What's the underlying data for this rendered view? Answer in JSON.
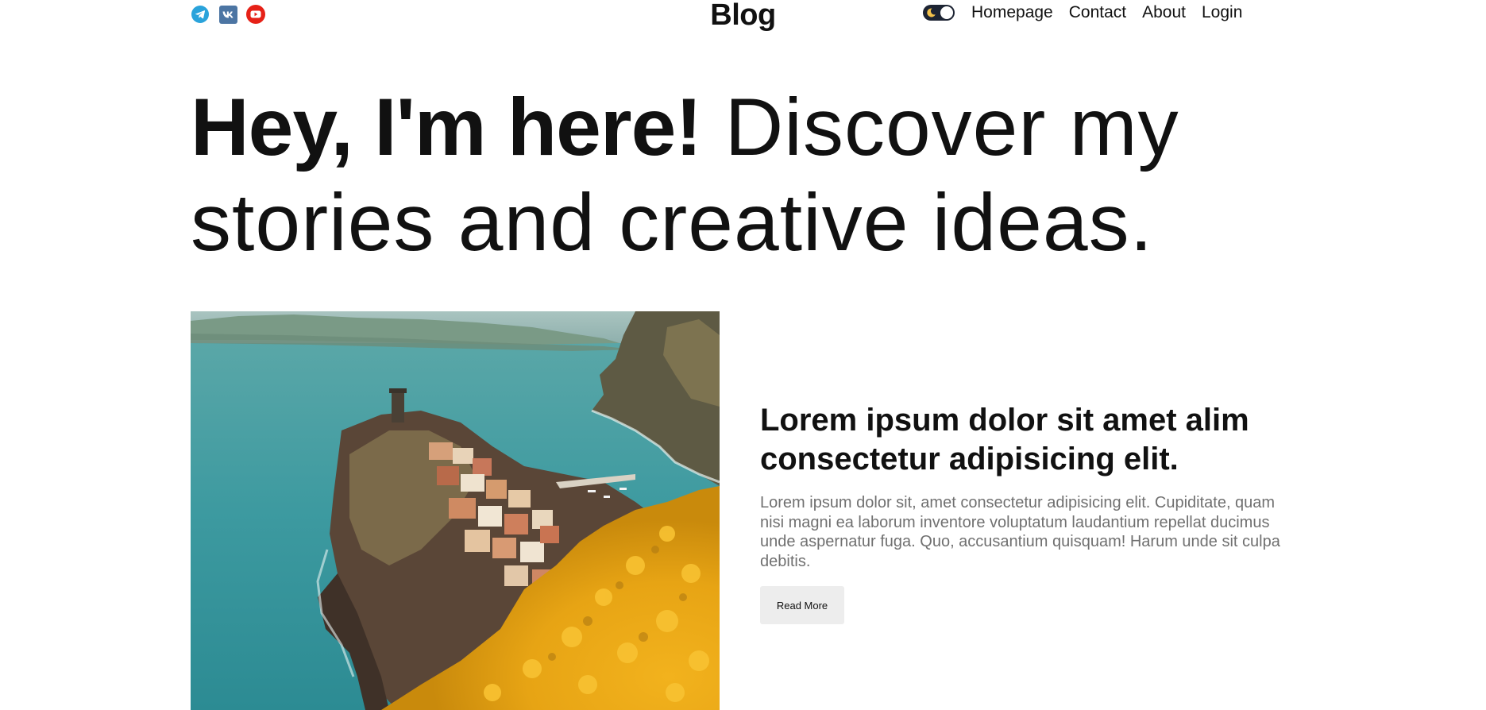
{
  "header": {
    "brand": "Blog",
    "socials": [
      {
        "icon": "telegram-icon",
        "color": "#2aa3db"
      },
      {
        "icon": "vk-icon",
        "color": "#4c75a3"
      },
      {
        "icon": "youtube-icon",
        "color": "#e62117"
      }
    ],
    "theme_toggle": {
      "icon": "moon-icon",
      "track_color": "#1d2433"
    },
    "nav": [
      {
        "label": "Homepage"
      },
      {
        "label": "Contact"
      },
      {
        "label": "About"
      },
      {
        "label": "Login"
      }
    ]
  },
  "hero": {
    "bold": "Hey, I'm here!",
    "light": " Discover my stories and creative ideas."
  },
  "featured_post": {
    "image_alt": "Coastal village on a cliff by the sea with yellow flowers",
    "title": "Lorem ipsum dolor sit amet alim consectetur adipisicing elit.",
    "excerpt": "Lorem ipsum dolor sit, amet consectetur adipisicing elit. Cupiditate, quam nisi magni ea laborum inventore voluptatum laudantium repellat ducimus unde aspernatur fuga. Quo, accusantium quisquam! Harum unde sit culpa debitis.",
    "cta": "Read More"
  }
}
